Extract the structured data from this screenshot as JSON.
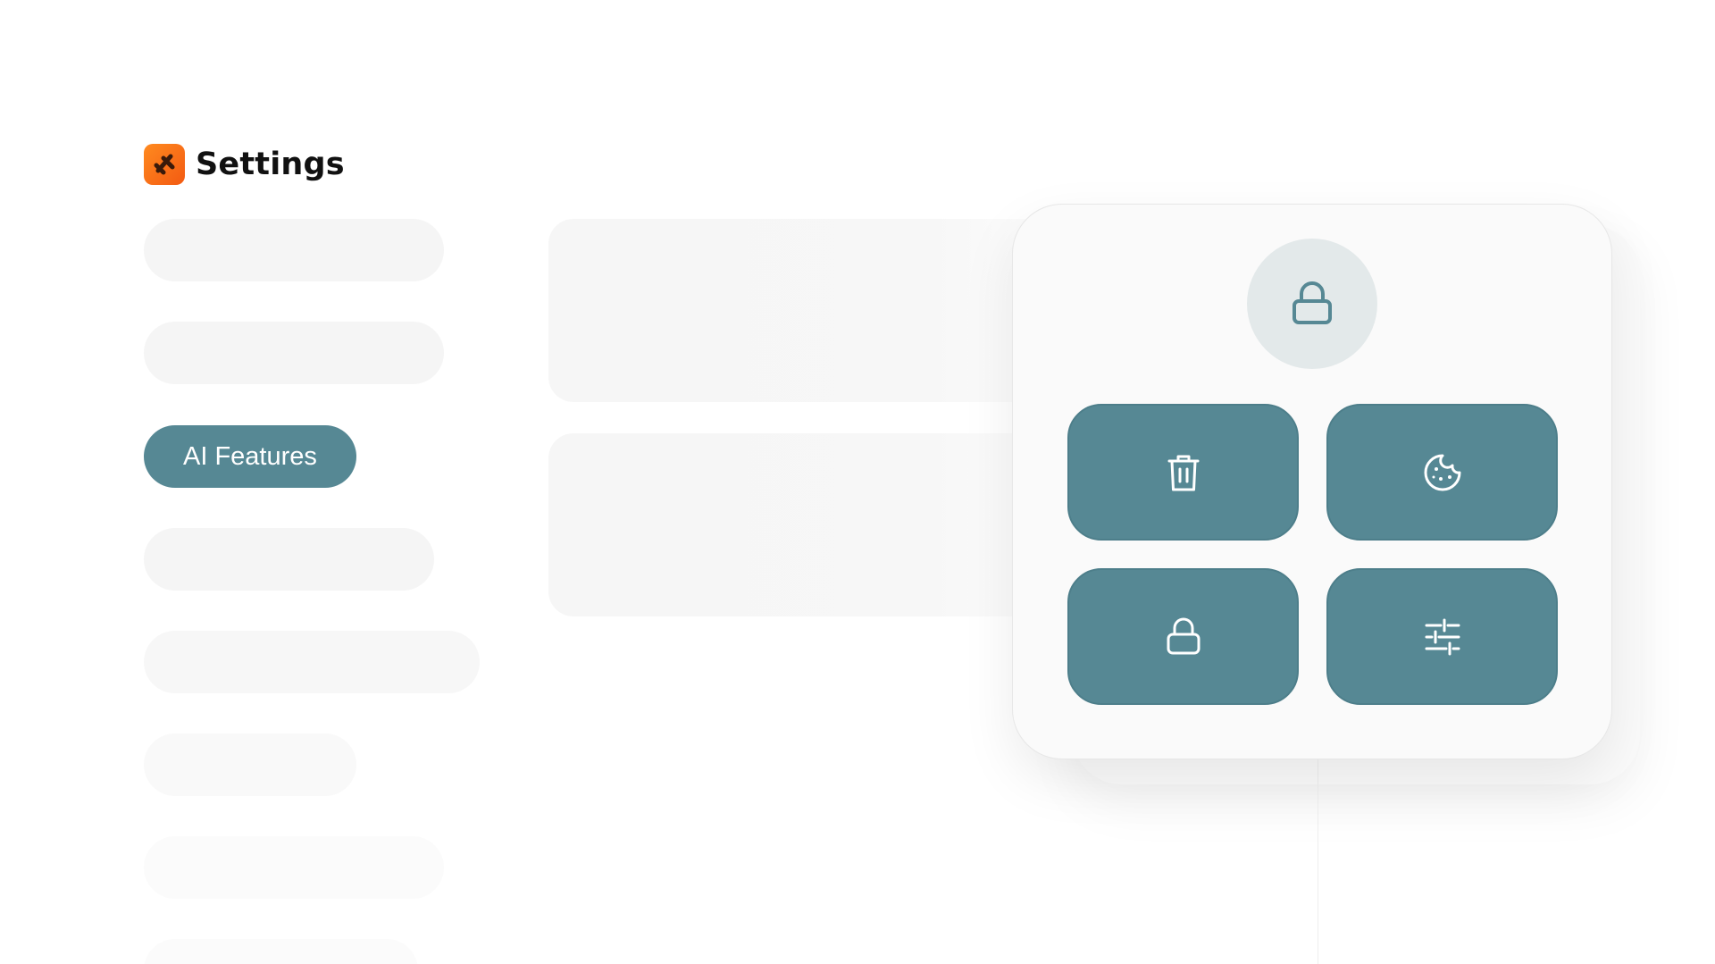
{
  "header": {
    "title": "Settings",
    "logo_icon": "app-logo-icon"
  },
  "sidebar": {
    "active_label": "AI Features",
    "active_color": "#568894"
  },
  "card": {
    "header_icon": "lock-icon",
    "tiles": [
      {
        "icon": "trash-icon"
      },
      {
        "icon": "cookie-icon"
      },
      {
        "icon": "lock-icon"
      },
      {
        "icon": "sliders-icon"
      }
    ],
    "tile_color": "#568894",
    "circle_color": "#e3e9ea"
  },
  "colors": {
    "brand_orange": "#f35a12",
    "accent_teal": "#568894"
  }
}
